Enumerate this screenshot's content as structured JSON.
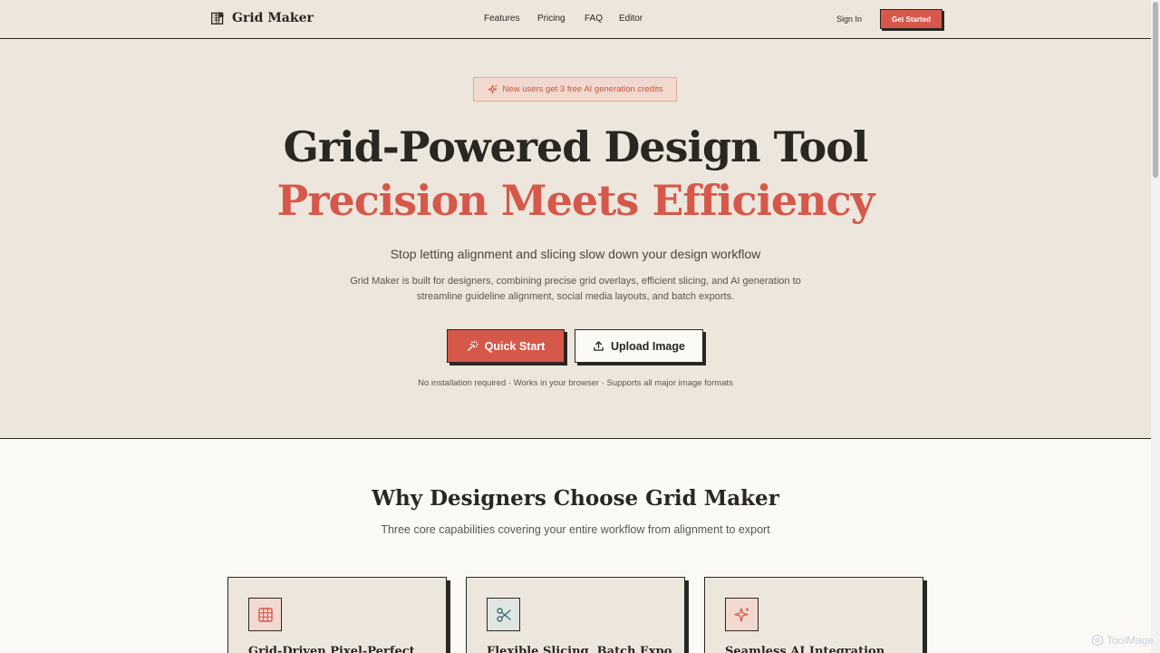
{
  "header": {
    "logo_text": "Grid Maker",
    "nav": [
      "Features",
      "Pricing",
      "FAQ",
      "Editor"
    ],
    "sign_in": "Sign In",
    "get_started": "Get Started"
  },
  "hero": {
    "badge": "New users get 3 free AI generation credits",
    "title_line1": "Grid-Powered Design Tool",
    "title_line2": "Precision Meets Efficiency",
    "subtitle": "Stop letting alignment and slicing slow down your design workflow",
    "description": "Grid Maker is built for designers, combining precise grid overlays, efficient slicing, and AI generation to streamline guideline alignment, social media layouts, and batch exports.",
    "quick_start": "Quick Start",
    "upload_image": "Upload Image",
    "note": "No installation required · Works in your browser · Supports all major image formats"
  },
  "features": {
    "title": "Why Designers Choose Grid Maker",
    "subtitle": "Three core capabilities covering your entire workflow from alignment to export",
    "cards": [
      {
        "title": "Grid-Driven Pixel-Perfect",
        "icon": "grid-icon"
      },
      {
        "title": "Flexible Slicing, Batch Export",
        "icon": "scissors-icon"
      },
      {
        "title": "Seamless AI Integration",
        "icon": "sparkle-icon"
      }
    ]
  },
  "watermark": "ToolMage",
  "colors": {
    "accent": "#d5584b",
    "ink": "#2a2723",
    "hero_bg": "#ece6dc",
    "page_bg": "#fbf9f5",
    "teal_icon": "#3d6b72"
  }
}
